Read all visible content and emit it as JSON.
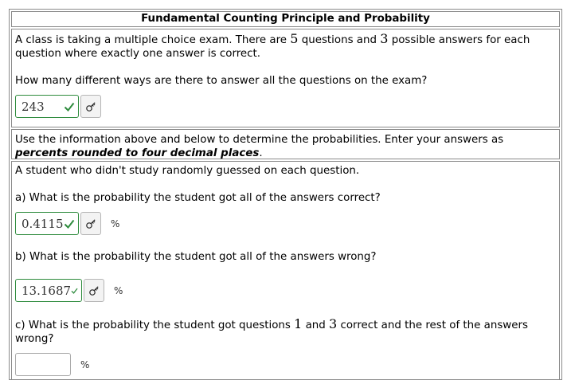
{
  "title": "Fundamental Counting Principle and Probability",
  "intro": {
    "text_a": "A class is taking a multiple choice exam. There are ",
    "num_questions": "5",
    "text_b": " questions and ",
    "num_answers": "3",
    "text_c": " possible answers for each question where exactly one answer is correct.",
    "question": "How many different ways are there to answer all the questions on the exam?",
    "answer": "243"
  },
  "instructions": {
    "text": "Use the information above and below to determine the probabilities. Enter your answers as ",
    "emphasis": "percents rounded to four decimal places",
    "end": "."
  },
  "scenario": "A student who didn't study randomly guessed on each question.",
  "parts": {
    "a": {
      "question": "a) What is the probability the student got all of the answers correct?",
      "answer": "0.4115",
      "unit": "%"
    },
    "b": {
      "question": "b) What is the probability the student got all of the answers wrong?",
      "answer": "13.1687",
      "unit": "%"
    },
    "c": {
      "q1": "c) What is the probability the student got questions ",
      "n1": "1",
      "q2": " and ",
      "n2": "3",
      "q3": " correct and the rest of the answers wrong?",
      "answer": "",
      "unit": "%"
    }
  },
  "icons": {
    "check": "check-icon",
    "key": "key-icon"
  },
  "colors": {
    "correct_border": "#2e8b3d",
    "check": "#2e8b3d"
  }
}
